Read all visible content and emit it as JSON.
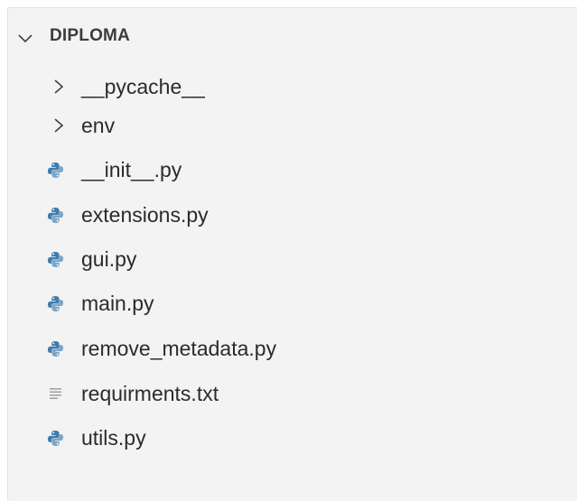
{
  "explorer": {
    "root": {
      "label": "DIPLOMA",
      "icon": "chevron-down-icon",
      "expanded": true
    },
    "items": [
      {
        "label": "__pycache__",
        "kind": "folder",
        "icon": "chevron-right-icon",
        "expanded": false
      },
      {
        "label": "env",
        "kind": "folder",
        "icon": "chevron-right-icon",
        "expanded": false
      },
      {
        "label": "__init__.py",
        "kind": "python-file",
        "icon": "python-file-icon"
      },
      {
        "label": "extensions.py",
        "kind": "python-file",
        "icon": "python-file-icon"
      },
      {
        "label": "gui.py",
        "kind": "python-file",
        "icon": "python-file-icon"
      },
      {
        "label": "main.py",
        "kind": "python-file",
        "icon": "python-file-icon"
      },
      {
        "label": "remove_metadata.py",
        "kind": "python-file",
        "icon": "python-file-icon"
      },
      {
        "label": "requirments.txt",
        "kind": "text-file",
        "icon": "text-file-icon"
      },
      {
        "label": "utils.py",
        "kind": "python-file",
        "icon": "python-file-icon"
      }
    ],
    "colors": {
      "background": "#f3f3f3",
      "text": "#2b2b2b",
      "python_blue": "#3f7cac",
      "python_yellow": "#7ba6c9",
      "text_icon": "#a0a0a0"
    }
  }
}
